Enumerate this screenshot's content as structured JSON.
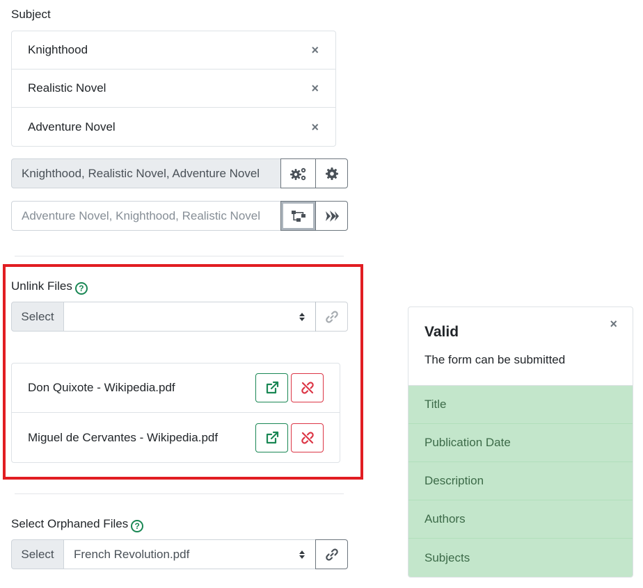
{
  "subject": {
    "label": "Subject",
    "items": [
      {
        "label": "Knighthood",
        "remove": "×"
      },
      {
        "label": "Realistic Novel",
        "remove": "×"
      },
      {
        "label": "Adventure Novel",
        "remove": "×"
      }
    ],
    "joined_value": "Knighthood, Realistic Novel, Adventure Novel",
    "sorted_placeholder": "Adventure Novel, Knighthood, Realistic Novel"
  },
  "unlink_files": {
    "label": "Unlink Files",
    "help": "?",
    "select_prefix": "Select",
    "select_value": "",
    "files": [
      {
        "name": "Don Quixote - Wikipedia.pdf"
      },
      {
        "name": "Miguel de Cervantes - Wikipedia.pdf"
      }
    ]
  },
  "orphaned": {
    "label": "Select Orphaned Files",
    "help": "?",
    "select_prefix": "Select",
    "select_value": "French Revolution.pdf"
  },
  "validation": {
    "title": "Valid",
    "message": "The form can be submitted",
    "close": "×",
    "fields": [
      "Title",
      "Publication Date",
      "Description",
      "Authors",
      "Subjects"
    ]
  },
  "colors": {
    "success": "#198754",
    "danger": "#dc3545",
    "highlight": "#e11d22",
    "valid_bg": "#c3e6cb"
  }
}
